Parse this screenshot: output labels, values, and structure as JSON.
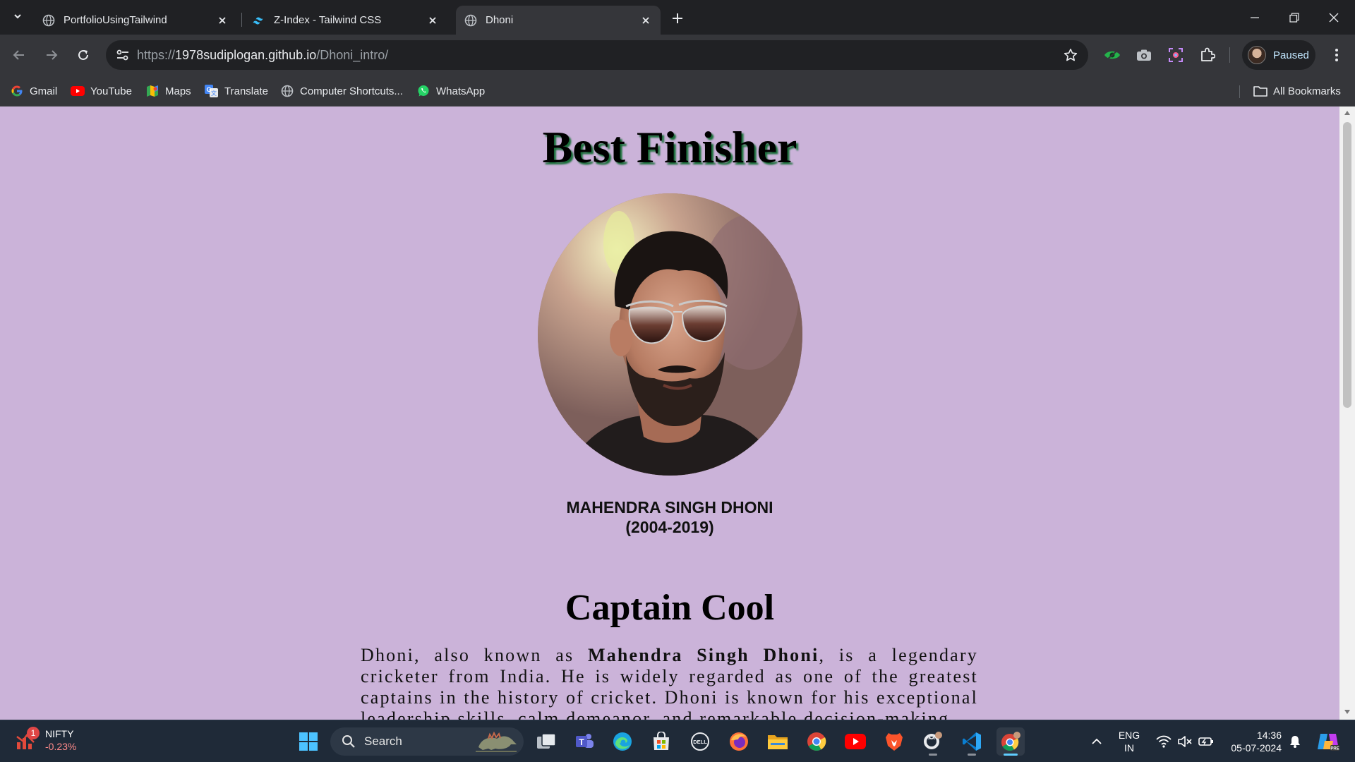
{
  "browser": {
    "tabs": [
      {
        "title": "PortfolioUsingTailwind",
        "favicon": "globe-icon",
        "active": false
      },
      {
        "title": "Z-Index - Tailwind CSS",
        "favicon": "tailwind-icon",
        "active": false
      },
      {
        "title": "Dhoni",
        "favicon": "globe-icon",
        "active": true
      }
    ],
    "address": {
      "scheme": "https://",
      "host": "1978sudiplogan.github.io",
      "path": "/Dhoni_intro/"
    },
    "profile_label": "Paused",
    "bookmarks": [
      {
        "label": "Gmail",
        "icon": "google-icon"
      },
      {
        "label": "YouTube",
        "icon": "youtube-icon"
      },
      {
        "label": "Maps",
        "icon": "maps-icon"
      },
      {
        "label": "Translate",
        "icon": "translate-icon"
      },
      {
        "label": "Computer Shortcuts...",
        "icon": "globe-icon"
      },
      {
        "label": "WhatsApp",
        "icon": "whatsapp-icon"
      }
    ],
    "all_bookmarks_label": "All Bookmarks"
  },
  "page": {
    "title": "Best Finisher",
    "caption_name": "MAHENDRA SINGH DHONI",
    "caption_years": "(2004-2019)",
    "section_title": "Captain Cool",
    "bio_prefix": "Dhoni, also known as",
    "bio_bold": "Mahendra Singh Dhoni",
    "bio_rest": ", is a legendary cricketer from India. He is widely regarded as one of the greatest captains in the history of cricket. Dhoni is known for his exceptional leadership skills, calm demeanor, and remarkable decision-making"
  },
  "taskbar": {
    "stock_name": "NIFTY",
    "stock_change": "-0.23%",
    "stock_badge": "1",
    "search_label": "Search",
    "lang_top": "ENG",
    "lang_bottom": "IN",
    "time": "14:36",
    "date": "05-07-2024"
  },
  "colors": {
    "page_background": "#cbb3d9",
    "title_shadow": "#1a6f3a",
    "chrome_dark": "#202124",
    "chrome_toolbar": "#35363a",
    "taskbar": "#1f2a38"
  }
}
